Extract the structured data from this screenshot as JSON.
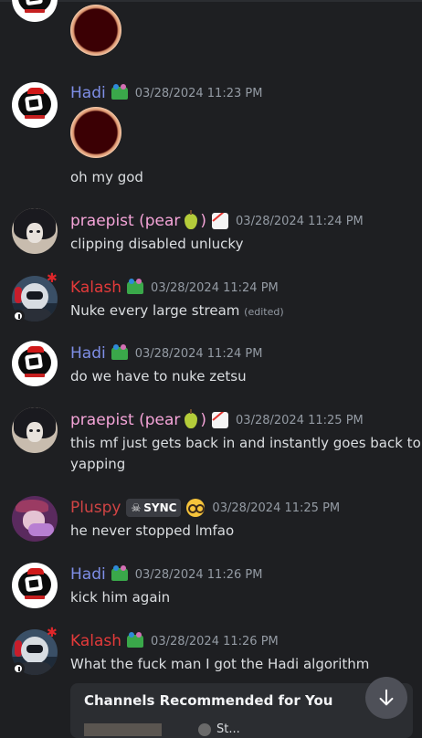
{
  "messages": [
    {
      "id": "partial",
      "username": "",
      "timestamp": "",
      "text": ""
    },
    {
      "id": "hadi-1",
      "username": "Hadi",
      "timestamp": "03/28/2024 11:23 PM",
      "text": "oh my god"
    },
    {
      "id": "praepist-1",
      "username": "praepist (pear",
      "username_close": ")",
      "timestamp": "03/28/2024 11:24 PM",
      "text": "clipping disabled unlucky"
    },
    {
      "id": "kalash-1",
      "username": "Kalash",
      "timestamp": "03/28/2024 11:24 PM",
      "text": "Nuke every large stream",
      "edited": "(edited)"
    },
    {
      "id": "hadi-2",
      "username": "Hadi",
      "timestamp": "03/28/2024 11:24 PM",
      "text": "do we have to nuke zetsu"
    },
    {
      "id": "praepist-2",
      "username": "praepist (pear",
      "username_close": ")",
      "timestamp": "03/28/2024 11:25 PM",
      "text_line1": "this mf just gets back in and instantly goes back to",
      "text_line2": "yapping"
    },
    {
      "id": "pluspy-1",
      "username": "Pluspy",
      "badge": "SYNC",
      "timestamp": "03/28/2024 11:25 PM",
      "text": "he never stopped lmfao"
    },
    {
      "id": "hadi-3",
      "username": "Hadi",
      "timestamp": "03/28/2024 11:26 PM",
      "text": "kick him again"
    },
    {
      "id": "kalash-2",
      "username": "Kalash",
      "timestamp": "03/28/2024 11:26 PM",
      "text": "What the fuck man I got the Hadi algorithm"
    }
  ],
  "embed": {
    "title": "Channels Recommended for You",
    "subtitle": "St..."
  },
  "colors": {
    "background": "#1e1f22",
    "hadi": "#7e8ee6",
    "praepist": "#f4a4d8",
    "kalash": "#e33a3a",
    "pluspy": "#d04444",
    "timestamp": "#949ba4"
  },
  "icons": {
    "scroll_down": "arrow-down-icon"
  }
}
